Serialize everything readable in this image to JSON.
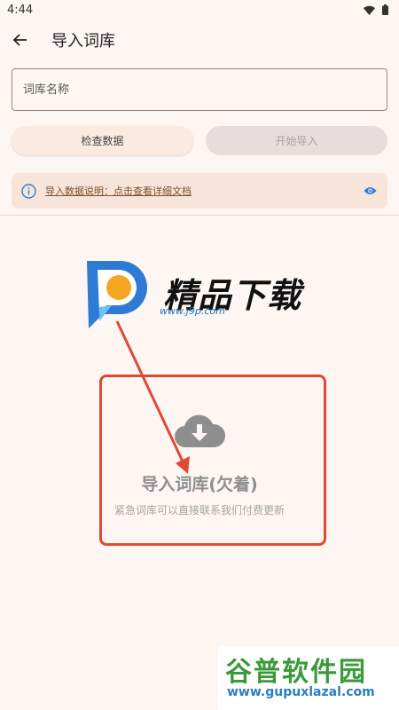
{
  "status_bar": {
    "time": "4:44"
  },
  "app_bar": {
    "title": "导入词库"
  },
  "form": {
    "name_placeholder": "词库名称"
  },
  "actions": {
    "check_label": "检查数据",
    "start_label": "开始导入"
  },
  "info_banner": {
    "link_text": "导入数据说明：点击查看详细文档"
  },
  "watermark": {
    "brand": "精品下载",
    "url": "www.j9p.com"
  },
  "import_zone": {
    "title": "导入词库(欠着)",
    "subtitle": "紧急词库可以直接联系我们付费更新"
  },
  "corner_watermark": {
    "title": "谷普软件园",
    "url": "www.gupuxlazal.com"
  },
  "colors": {
    "accent": "#e04a35",
    "banner": "#f7e4da",
    "link": "#7a5230",
    "eye": "#2a7fd4"
  }
}
